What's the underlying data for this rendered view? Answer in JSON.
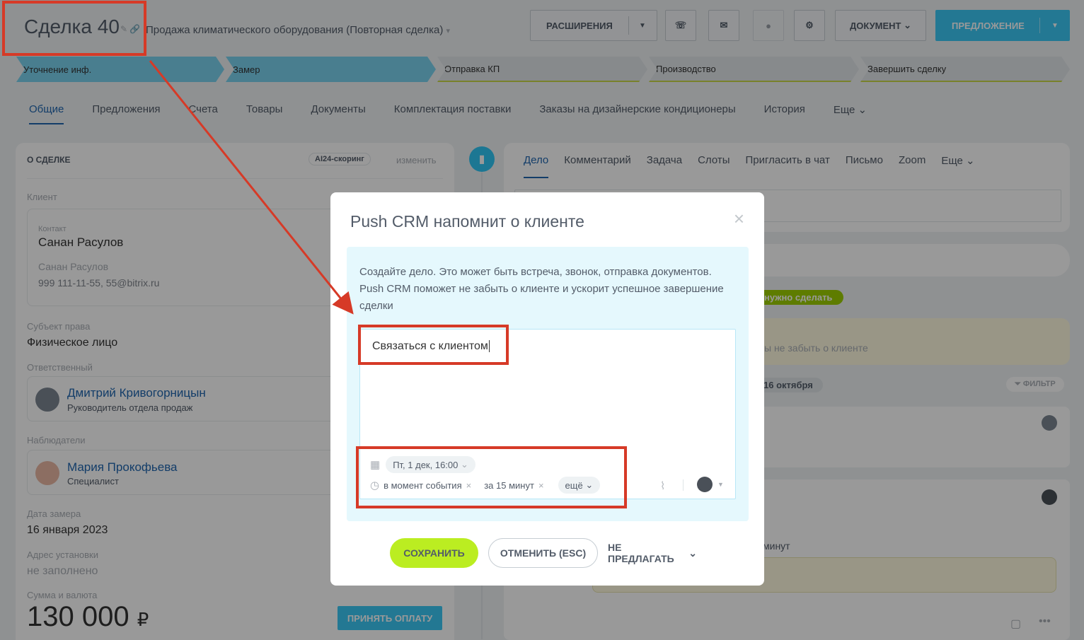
{
  "header": {
    "title": "Сделка 40",
    "subtitle": "Продажа климатического оборудования (Повторная сделка)",
    "extensions": "РАСШИРЕНИЯ",
    "document": "ДОКУМЕНТ",
    "offer": "ПРЕДЛОЖЕНИЕ"
  },
  "pipeline": [
    {
      "label": "Уточнение инф."
    },
    {
      "label": "Замер"
    },
    {
      "label": "Отправка КП"
    },
    {
      "label": "Производство"
    },
    {
      "label": "Завершить сделку"
    }
  ],
  "tabs": [
    "Общие",
    "Предложения",
    "Счета",
    "Товары",
    "Документы",
    "Комплектация поставки",
    "Заказы на дизайнерские кондиционеры",
    "История",
    "Еще"
  ],
  "deal": {
    "section_title": "О СДЕЛКЕ",
    "scoring": "AI24-скоринг",
    "edit": "изменить",
    "client_label": "Клиент",
    "contact_label": "Контакт",
    "contact_name": "Санан Расулов",
    "contact_sub": "Санан Расулов",
    "contact_info": "999 111-11-55, 55@bitrix.ru",
    "legal_label": "Субъект права",
    "legal_value": "Физическое лицо",
    "responsible_label": "Ответственный",
    "responsible_name": "Дмитрий Кривогорницын",
    "responsible_role": "Руководитель отдела продаж",
    "observers_label": "Наблюдатели",
    "observer_name": "Мария Прокофьева",
    "observer_role": "Специалист",
    "measure_label": "Дата замера",
    "measure_value": "16 января 2023",
    "address_label": "Адрес установки",
    "address_value": "не заполнено",
    "sum_label": "Сумма и валюта",
    "sum_value": "130 000",
    "currency": "₽",
    "pay_button": "ПРИНЯТЬ ОПЛАТУ"
  },
  "activity": {
    "tabs": [
      "Дело",
      "Комментарий",
      "Задача",
      "Слоты",
      "Пригласить в чат",
      "Письмо",
      "Zoom",
      "Еще"
    ],
    "todo_badge": "нужно сделать",
    "hint": "ы не забыть о клиенте",
    "date_badge": "16 октября",
    "filter": "ФИЛЬТР",
    "minutes": "минут"
  },
  "modal": {
    "title": "Push CRM напомнит о клиенте",
    "text": "Создайте дело. Это может быть встреча, звонок, отправка документов. Push CRM поможет не забыть о клиенте и ускорит успешное завершение сделки",
    "input_value": "Связаться с клиентом",
    "date": "Пт, 1 дек, 16:00",
    "reminder1": "в момент события",
    "reminder2": "за 15 минут",
    "more": "ещё",
    "save": "СОХРАНИТЬ",
    "cancel": "ОТМЕНИТЬ (ESC)",
    "dont_offer": "НЕ ПРЕДЛАГАТЬ"
  },
  "colors": {
    "accent_blue": "#3bc8f5",
    "save_green": "#bbed21",
    "annotation_red": "#d63a27"
  }
}
